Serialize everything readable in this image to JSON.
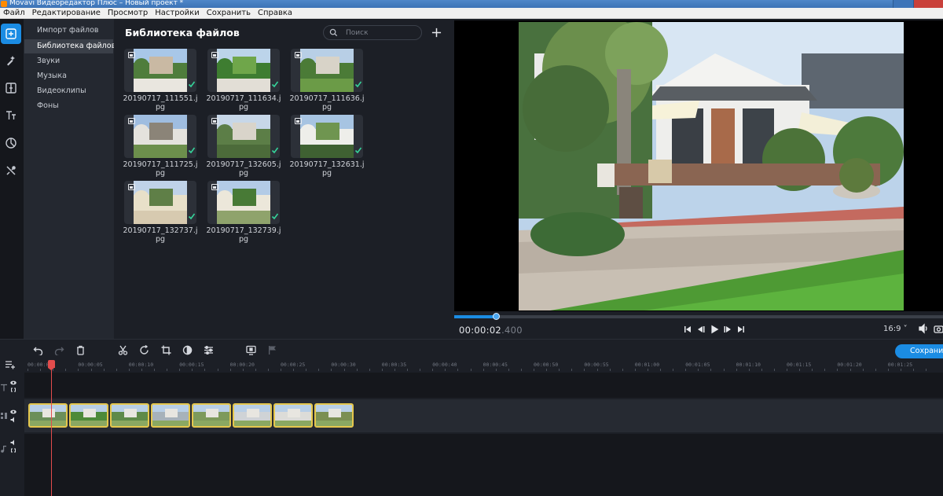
{
  "window": {
    "title": "Movavi Видеоредактор Плюс – Новый проект *"
  },
  "menu": [
    "Файл",
    "Редактирование",
    "Просмотр",
    "Настройки",
    "Сохранить",
    "Справка"
  ],
  "categories": [
    {
      "label": "Импорт файлов",
      "active": false
    },
    {
      "label": "Библиотека файлов",
      "active": true
    },
    {
      "label": "Звуки",
      "active": false
    },
    {
      "label": "Музыка",
      "active": false
    },
    {
      "label": "Видеоклипы",
      "active": false
    },
    {
      "label": "Фоны",
      "active": false
    }
  ],
  "library": {
    "title": "Библиотека файлов",
    "search_placeholder": "Поиск",
    "files": [
      {
        "name": "20190717_111551.jpg",
        "used": true
      },
      {
        "name": "20190717_111634.jpg",
        "used": true
      },
      {
        "name": "20190717_111636.jpg",
        "used": true
      },
      {
        "name": "20190717_111725.jpg",
        "used": true
      },
      {
        "name": "20190717_132605.jpg",
        "used": true
      },
      {
        "name": "20190717_132631.jpg",
        "used": true
      },
      {
        "name": "20190717_132737.jpg",
        "used": true
      },
      {
        "name": "20190717_132739.jpg",
        "used": true
      }
    ]
  },
  "player": {
    "time_main": "00:00:02",
    "time_ms": ".400",
    "progress": 0.085,
    "aspect": "16:9"
  },
  "timeline": {
    "export_label": "Сохранить",
    "ruler": [
      "00:00:00",
      "00:00:05",
      "00:00:10",
      "00:00:15",
      "00:00:20",
      "00:00:25",
      "00:00:30",
      "00:00:35",
      "00:00:40",
      "00:00:45",
      "00:00:50",
      "00:00:55",
      "00:01:00",
      "00:01:05",
      "00:01:10",
      "00:01:15",
      "00:01:20",
      "00:01:25"
    ],
    "clips": 8,
    "playhead_seconds": 2.4
  },
  "colors": {
    "accent": "#1b8ce3",
    "clip_border": "#e5c74d",
    "playhead": "#e24c4c",
    "used_check": "#35d39a"
  }
}
